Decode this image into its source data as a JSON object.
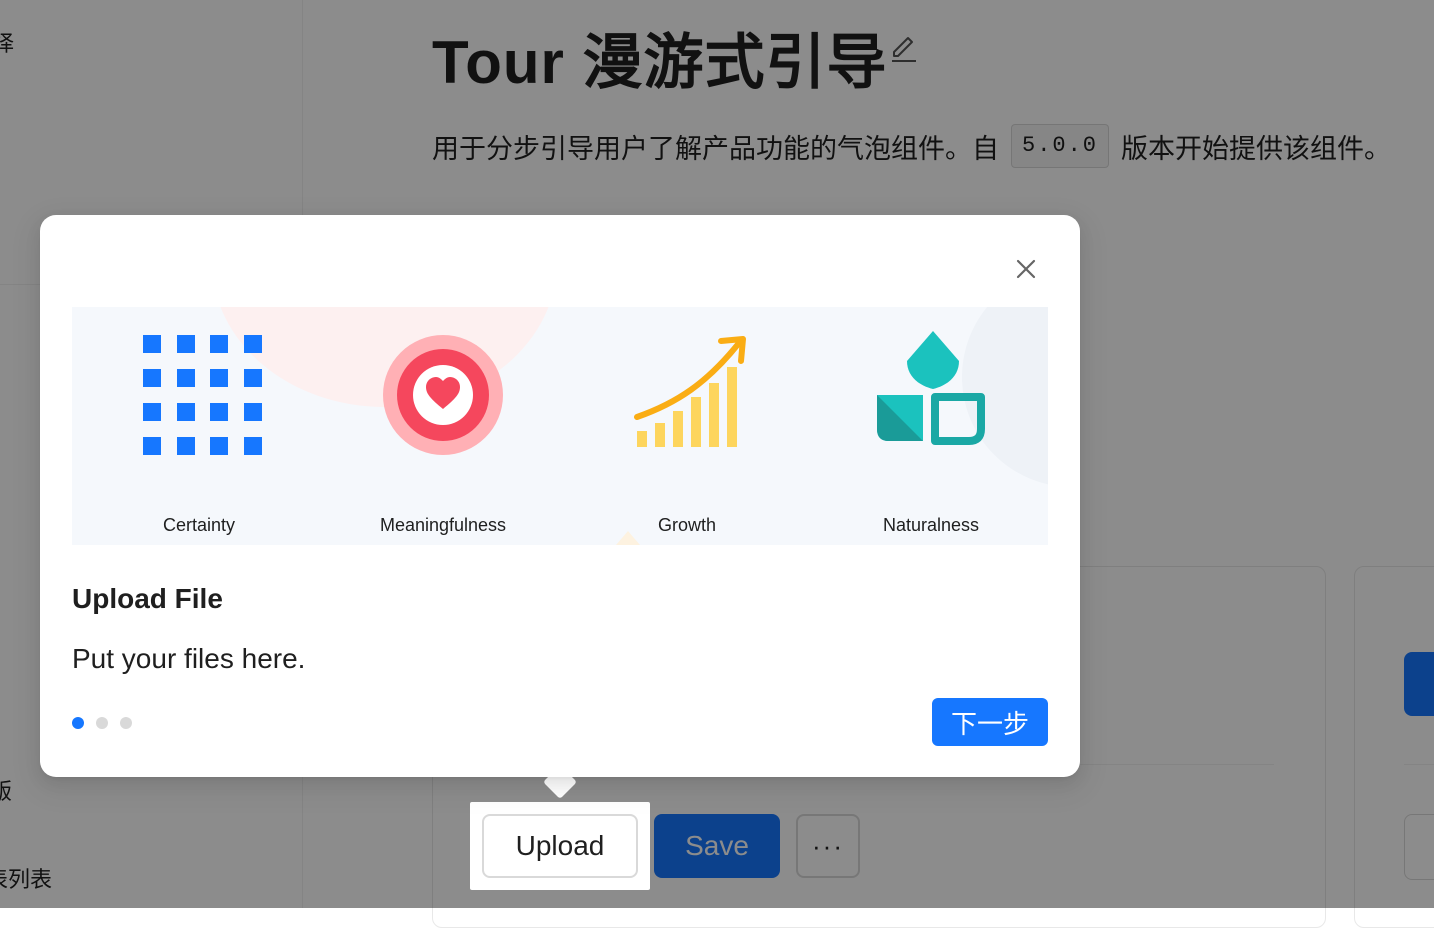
{
  "sidebar": {
    "item_top": "择",
    "item_bottom1": "版",
    "item_bottom2": "表列表"
  },
  "header": {
    "title": "Tour 漫游式引导",
    "description_prefix": "用于分步引导用户了解产品功能的气泡组件。自",
    "version": "5.0.0",
    "description_suffix": "版本开始提供该组件。"
  },
  "demo": {
    "upload_label": "Upload",
    "save_label": "Save",
    "more_label": "···"
  },
  "tour": {
    "cover_items": [
      {
        "label": "Certainty",
        "icon": "grid-icon",
        "color": "#1677ff"
      },
      {
        "label": "Meaningfulness",
        "icon": "heart-icon",
        "color": "#f5475d"
      },
      {
        "label": "Growth",
        "icon": "growth-chart-icon",
        "color": "#fdc53f"
      },
      {
        "label": "Naturalness",
        "icon": "leaf-icon",
        "color": "#1bc2be"
      }
    ],
    "title": "Upload File",
    "description": "Put your files here.",
    "current_step": 1,
    "total_steps": 3,
    "next_label": "下一步"
  },
  "colors": {
    "primary": "#1677ff",
    "mask": "rgba(0,0,0,0.45)"
  }
}
